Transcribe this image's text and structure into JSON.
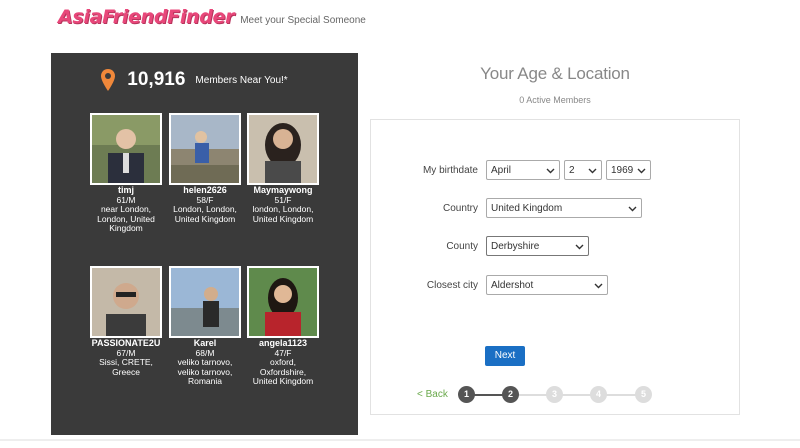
{
  "header": {
    "logo": "AsiaFriendFinder",
    "tagline": "Meet your Special Someone"
  },
  "near": {
    "count": "10,916",
    "text": "Members Near You!*",
    "icon": "map-pin-icon",
    "icon_color": "#f0883a"
  },
  "members": [
    {
      "name": "timj",
      "age_sex": "61/M",
      "loc1": "near London,",
      "loc2": "London, United",
      "loc3": "Kingdom"
    },
    {
      "name": "helen2626",
      "age_sex": "58/F",
      "loc1": "London, London,",
      "loc2": "United Kingdom",
      "loc3": ""
    },
    {
      "name": "Maymaywong",
      "age_sex": "51/F",
      "loc1": "london, London,",
      "loc2": "United Kingdom",
      "loc3": ""
    },
    {
      "name": "PASSIONATE2U",
      "age_sex": "67/M",
      "loc1": "Sissi, CRETE,",
      "loc2": "Greece",
      "loc3": ""
    },
    {
      "name": "Karel",
      "age_sex": "68/M",
      "loc1": "veliko tarnovo,",
      "loc2": "veliko tarnovo,",
      "loc3": "Romania"
    },
    {
      "name": "angela1123",
      "age_sex": "47/F",
      "loc1": "oxford,",
      "loc2": "Oxfordshire,",
      "loc3": "United Kingdom"
    }
  ],
  "form": {
    "title": "Your Age & Location",
    "active": "0 Active Members",
    "birthdate_label": "My birthdate",
    "birth_month": "April",
    "birth_day": "2",
    "birth_year": "1969",
    "country_label": "Country",
    "country": "United Kingdom",
    "county_label": "County",
    "county": "Derbyshire",
    "city_label": "Closest city",
    "city": "Aldershot",
    "next": "Next",
    "back": "< Back",
    "steps": [
      "1",
      "2",
      "3",
      "4",
      "5"
    ],
    "current_step": 2
  },
  "colors": {
    "panel": "#3a3a3a",
    "accent": "#1a6fc4",
    "logo": "#e8477a",
    "back_link": "#6aa94c"
  }
}
